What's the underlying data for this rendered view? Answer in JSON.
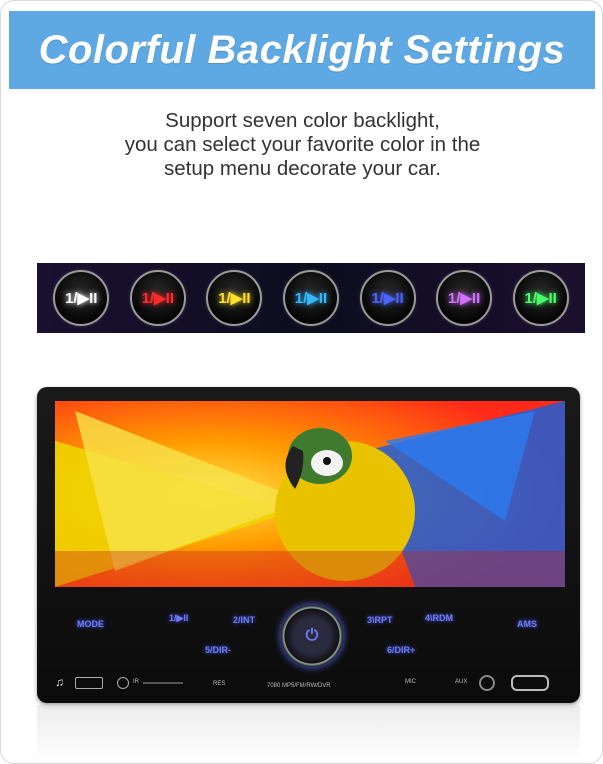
{
  "banner": {
    "title": "Colorful Backlight Settings"
  },
  "description": {
    "line1": "Support seven color backlight,",
    "line2": "you can select your favorite color in the",
    "line3": "setup menu decorate your car."
  },
  "backlight_buttons": [
    {
      "label": "1/▶II",
      "color": "#ffffff"
    },
    {
      "label": "1/▶II",
      "color": "#ff2a2a"
    },
    {
      "label": "1/▶II",
      "color": "#ffe02a"
    },
    {
      "label": "1/▶II",
      "color": "#33b8ff"
    },
    {
      "label": "1/▶II",
      "color": "#4c64ff"
    },
    {
      "label": "1/▶II",
      "color": "#d070ff"
    },
    {
      "label": "1/▶II",
      "color": "#4cff6a"
    }
  ],
  "device": {
    "keys": {
      "mode": "MODE",
      "k1": "1/▶II",
      "k2": "2/INT",
      "k3": "3\\RPT",
      "k4": "4\\RDM",
      "ams": "AMS",
      "k5": "5/DIR-",
      "k6": "6/DIR+"
    },
    "labels": {
      "ir": "IR",
      "res": "RES",
      "model": "7080   MP5/FM/RW/DVR",
      "mic": "MIC",
      "aux": "AUX"
    },
    "power_icon": "power-icon",
    "music_icon": "music-note-icon"
  }
}
